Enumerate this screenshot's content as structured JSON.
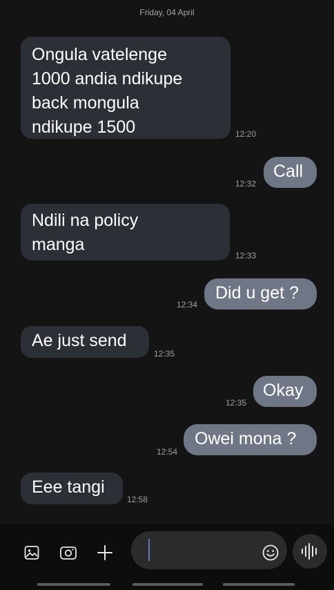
{
  "date_header": "Friday, 04 April",
  "messages": [
    {
      "dir": "in",
      "text": "Ongula vatelenge\n1000 andia ndikupe\nback mongula\nndikupe 1500",
      "time": "12:20"
    },
    {
      "dir": "out",
      "text": "Call",
      "time": "12:32"
    },
    {
      "dir": "in",
      "text": "Ndili na policy\nmanga",
      "time": "12:33"
    },
    {
      "dir": "out",
      "text": "Did u get ?",
      "time": "12:34"
    },
    {
      "dir": "in",
      "text": "Ae just send",
      "time": "12:35"
    },
    {
      "dir": "out",
      "text": "Okay",
      "time": "12:35"
    },
    {
      "dir": "out",
      "text": "Owei mona ?",
      "time": "12:54"
    },
    {
      "dir": "in",
      "text": "Eee tangi",
      "time": "12:58"
    }
  ],
  "composer": {
    "icons": [
      "gallery-icon",
      "camera-icon",
      "add-icon",
      "emoji-icon",
      "voice-wave-icon"
    ]
  }
}
